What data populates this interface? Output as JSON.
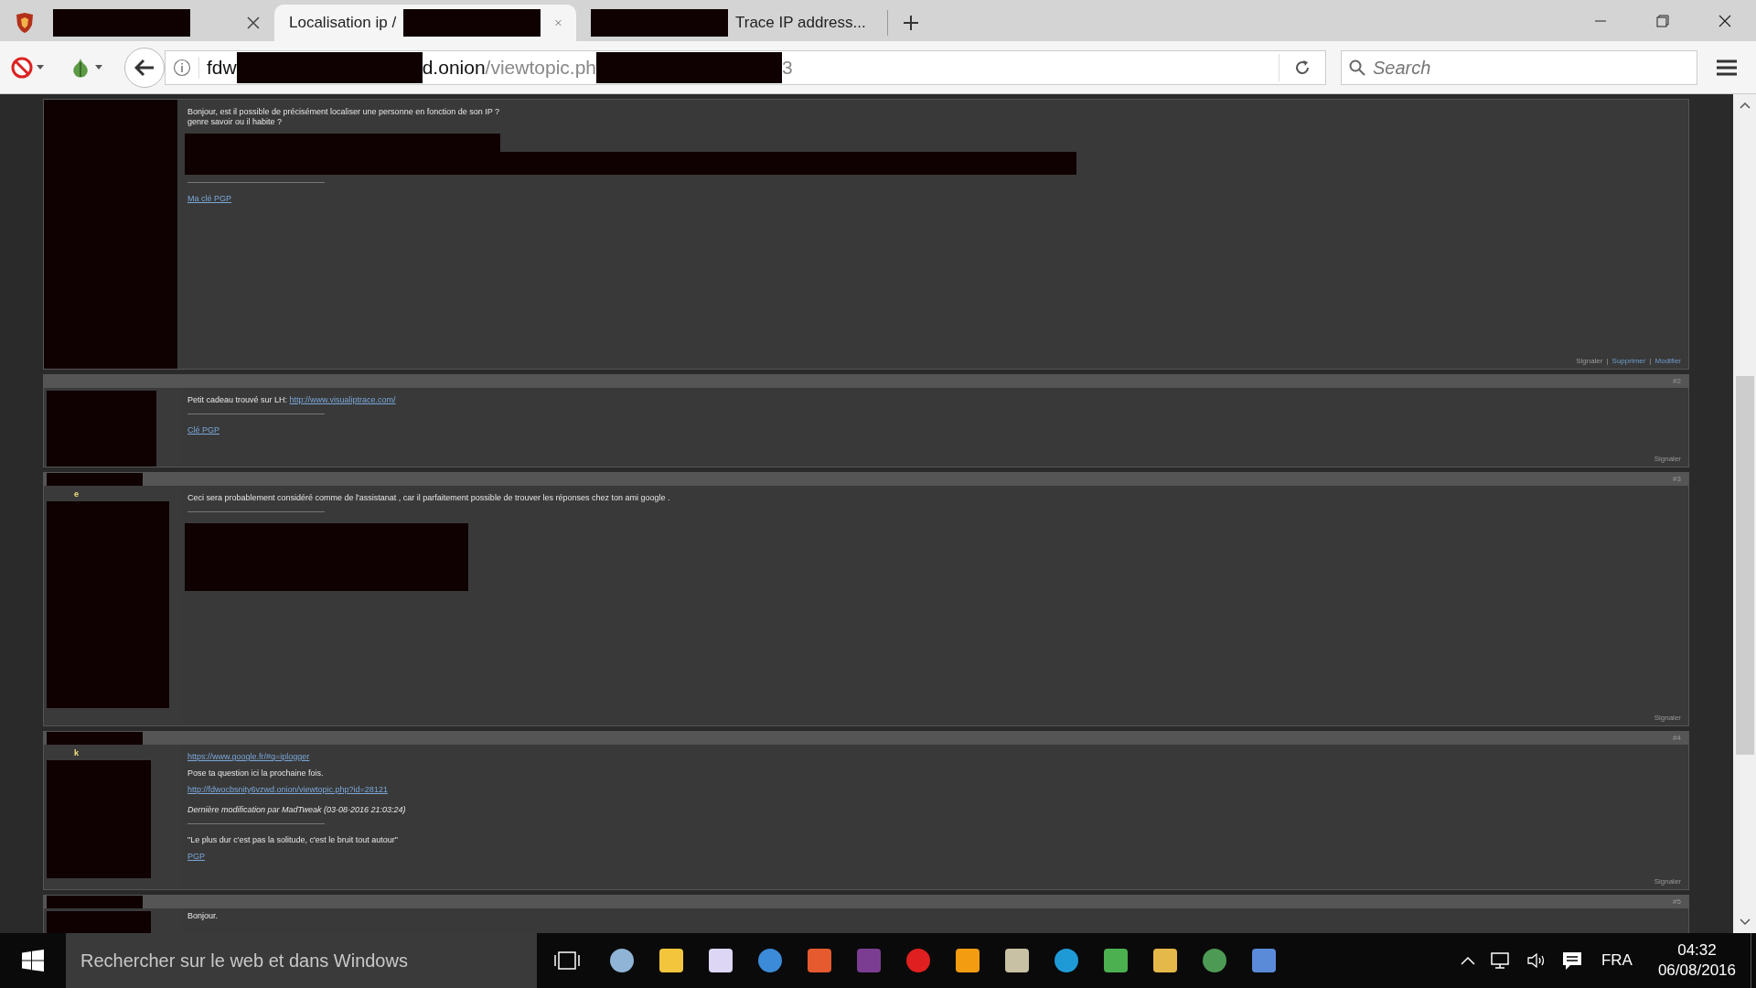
{
  "tabs": [
    {
      "selected": false,
      "segments": [
        {
          "kind": "redacted"
        }
      ]
    },
    {
      "selected": true,
      "segments": [
        {
          "kind": "text",
          "text": "Localisation ip /"
        },
        {
          "kind": "redacted"
        }
      ]
    },
    {
      "selected": false,
      "segments": [
        {
          "kind": "redacted"
        },
        {
          "kind": "text",
          "text": "Trace IP address..."
        }
      ]
    }
  ],
  "address_bar": {
    "segments": [
      {
        "kind": "host",
        "text": "fdw"
      },
      {
        "kind": "redacted"
      },
      {
        "kind": "host",
        "text": "d.onion"
      },
      {
        "kind": "path",
        "text": "/viewtopic.ph"
      },
      {
        "kind": "redacted"
      },
      {
        "kind": "path",
        "text": "3"
      }
    ]
  },
  "search": {
    "placeholder": "Search"
  },
  "posts": [
    {
      "header_redacted": false,
      "content": [
        {
          "kind": "text",
          "text": "Bonjour, est il possible de précisément localiser une personne en fonction de son IP ?\ngenre savoir ou il habite ?"
        },
        {
          "kind": "redacted_line"
        },
        {
          "kind": "redacted_wide"
        },
        {
          "kind": "rule"
        },
        {
          "kind": "link",
          "text": "Ma clé PGP"
        }
      ],
      "actions": [
        {
          "kind": "plain",
          "text": "Signaler"
        },
        {
          "kind": "separator",
          "text": "|"
        },
        {
          "kind": "link",
          "text": "Supprimer"
        },
        {
          "kind": "separator",
          "text": "|"
        },
        {
          "kind": "link",
          "text": "Modifier"
        }
      ]
    },
    {
      "number": "#2",
      "header_redacted": false,
      "content": [
        {
          "kind": "mixed",
          "parts": [
            {
              "kind": "text",
              "text": "Petit cadeau trouvé sur LH: "
            },
            {
              "kind": "link",
              "text": "http://www.visualiptrace.com/"
            }
          ]
        },
        {
          "kind": "rule"
        },
        {
          "kind": "link",
          "text": "Clé PGP"
        }
      ],
      "actions": [
        {
          "kind": "plain",
          "text": "Signaler"
        }
      ]
    },
    {
      "number": "#3",
      "username": "e",
      "header_redacted": true,
      "content": [
        {
          "kind": "text",
          "text": "Ceci sera probablement considéré comme de l'assistanat , car il parfaitement possible de trouver les réponses chez ton ami google ."
        },
        {
          "kind": "rule"
        },
        {
          "kind": "redacted_image"
        }
      ],
      "actions": [
        {
          "kind": "plain",
          "text": "Signaler"
        }
      ]
    },
    {
      "number": "#4",
      "username": "k",
      "header_redacted": true,
      "content": [
        {
          "kind": "link",
          "text": "https://www.google.fr/#q=iplogger"
        },
        {
          "kind": "text",
          "text": "Pose ta question ici la prochaine fois."
        },
        {
          "kind": "link",
          "text": "http://fdwocbsnity6vzwd.onion/viewtopic.php?id=28121"
        },
        {
          "kind": "italic",
          "text": "Dernière modification par MadTweak (03-08-2016 21:03:24)"
        },
        {
          "kind": "rule"
        },
        {
          "kind": "text",
          "text": "\"Le plus dur c'est pas la solitude, c'est le bruit tout autour\""
        },
        {
          "kind": "link",
          "text": "PGP"
        }
      ],
      "actions": [
        {
          "kind": "plain",
          "text": "Signaler"
        }
      ]
    },
    {
      "number": "#5",
      "header_redacted": true,
      "content": [
        {
          "kind": "text",
          "text": "Bonjour."
        }
      ]
    }
  ],
  "taskbar": {
    "search_placeholder": "Rechercher sur le web et dans Windows",
    "language": "FRA",
    "time": "04:32",
    "date": "06/08/2016"
  }
}
